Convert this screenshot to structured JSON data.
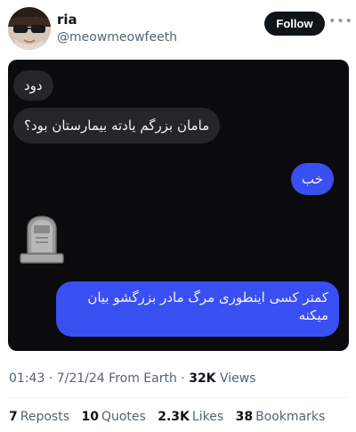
{
  "author": {
    "name": "ria",
    "handle": "@meowmeowfeeth",
    "follow_label": "Follow",
    "more_icon": "more-horizontal-icon"
  },
  "chat": {
    "messages": [
      {
        "side": "received",
        "text": "دود"
      },
      {
        "side": "received",
        "text": "مامان بزرگم یادته بیمارستان بود؟"
      },
      {
        "side": "sent",
        "text": "خب"
      },
      {
        "side": "received",
        "emoji": "headstone"
      },
      {
        "side": "sent",
        "text": "کمتر کسی اینطوری مرگ مادر بزرگشو بیان میکنه"
      }
    ],
    "colors": {
      "background": "#0b0b0d",
      "received_bubble": "#262629",
      "sent_bubble": "#3a4ff2"
    }
  },
  "meta": {
    "time": "01:43",
    "date": "7/21/24",
    "source": "From Earth",
    "views_count": "32K",
    "views_label": "Views"
  },
  "stats": {
    "reposts_count": "7",
    "reposts_label": "Reposts",
    "quotes_count": "10",
    "quotes_label": "Quotes",
    "likes_count": "2.3K",
    "likes_label": "Likes",
    "bookmarks_count": "38",
    "bookmarks_label": "Bookmarks"
  }
}
